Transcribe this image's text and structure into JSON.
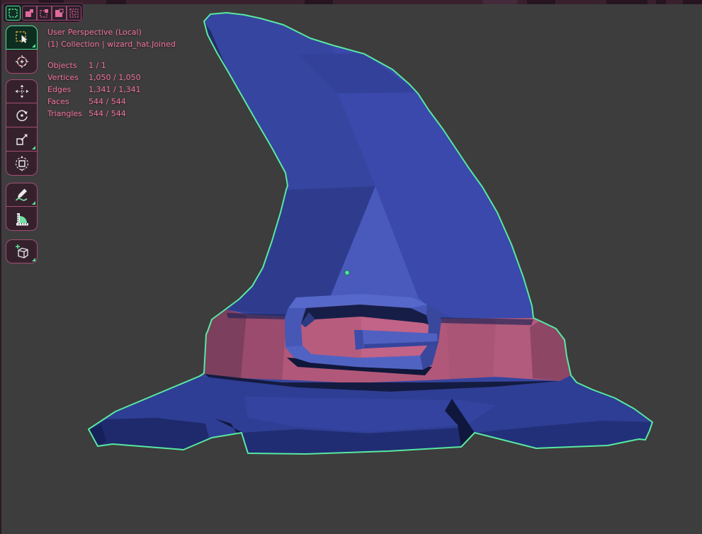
{
  "window": {
    "bg_color": "#3d3d3d",
    "topbar_color": "#38212d",
    "accent_green": "#54e19b",
    "accent_pink": "#f2709e",
    "toolbar_border": "#a34d72"
  },
  "tool_settings": {
    "modes": [
      {
        "icon": "mode-set-icon",
        "active": true
      },
      {
        "icon": "mode-extend-icon",
        "active": false
      },
      {
        "icon": "mode-subtract-icon",
        "active": false
      },
      {
        "icon": "mode-invert-icon",
        "active": false
      },
      {
        "icon": "mode-intersect-icon",
        "active": false
      }
    ]
  },
  "toolbar": {
    "tools": [
      {
        "name": "select-box",
        "active": true,
        "has_submenu": true
      },
      {
        "name": "cursor",
        "active": false,
        "has_submenu": false
      },
      {
        "name": "move",
        "active": false,
        "has_submenu": false
      },
      {
        "name": "rotate",
        "active": false,
        "has_submenu": false
      },
      {
        "name": "scale",
        "active": false,
        "has_submenu": true
      },
      {
        "name": "transform",
        "active": false,
        "has_submenu": false
      },
      {
        "name": "annotate",
        "active": false,
        "has_submenu": true
      },
      {
        "name": "measure",
        "active": false,
        "has_submenu": false
      },
      {
        "name": "add-cube",
        "active": false,
        "has_submenu": true
      }
    ]
  },
  "overlay": {
    "view_label": "User Perspective (Local)",
    "context_label": "(1) Collection | wizard_hat.Joined",
    "stats": [
      {
        "label": "Objects",
        "value": "1 / 1"
      },
      {
        "label": "Vertices",
        "value": "1,050 / 1,050"
      },
      {
        "label": "Edges",
        "value": "1,341 / 1,341"
      },
      {
        "label": "Faces",
        "value": "544 / 544"
      },
      {
        "label": "Triangles",
        "value": "544 / 544"
      }
    ]
  },
  "viewport": {
    "object_name": "wizard_hat.Joined",
    "selection_outline_color": "#58e9a0",
    "hat_blue": "#3b4bae",
    "hat_band_pink": "#b1587a",
    "origin_dot_color": "#52e8a6"
  }
}
